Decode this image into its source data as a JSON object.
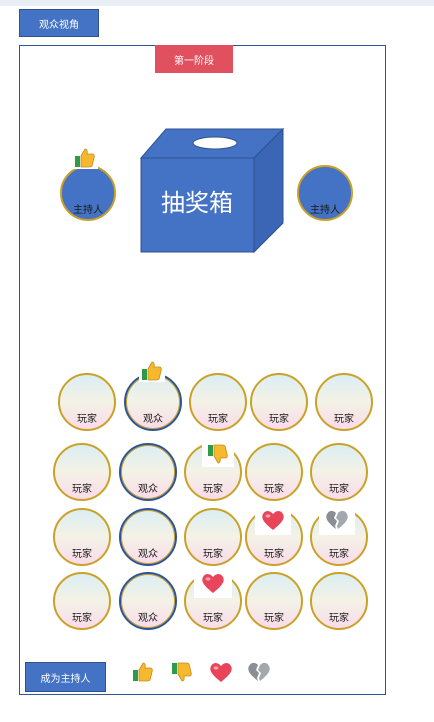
{
  "view_button": "观众视角",
  "phase_label": "第一阶段",
  "box_label": "抽奖箱",
  "hosts": [
    {
      "label": "主持人",
      "reaction": "thumbs-up-icon"
    },
    {
      "label": "主持人",
      "reaction": ""
    }
  ],
  "seats": [
    [
      "玩家",
      "观众",
      "玩家",
      "玩家",
      "玩家"
    ],
    [
      "玩家",
      "观众",
      "玩家",
      "玩家",
      "玩家"
    ],
    [
      "玩家",
      "观众",
      "玩家",
      "玩家",
      "玩家"
    ],
    [
      "玩家",
      "观众",
      "玩家",
      "玩家",
      "玩家"
    ]
  ],
  "become_host_button": "成为主持人",
  "reaction_bar": [
    "thumbs-up-icon",
    "thumbs-down-icon",
    "heart-icon",
    "broken-heart-icon"
  ],
  "colors": {
    "accent": "#4472c4",
    "phase": "#e0505e",
    "gold": "#c9a227"
  }
}
